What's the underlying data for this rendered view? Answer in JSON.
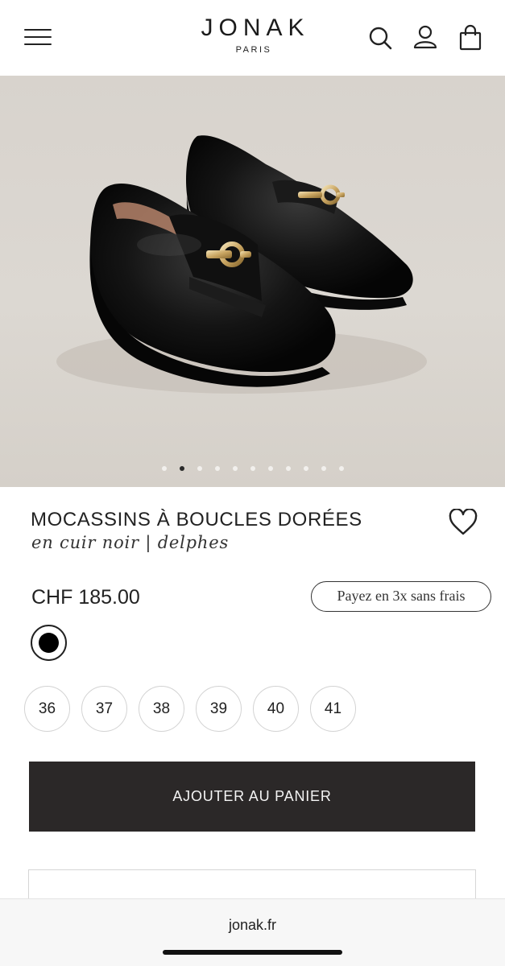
{
  "header": {
    "brand": "JONAK",
    "brand_sub": "PARIS",
    "icons": [
      "menu-icon",
      "search-icon",
      "account-icon",
      "bag-icon"
    ]
  },
  "gallery": {
    "image_count": 11,
    "active_index": 1,
    "dot_color": "#f2f0ed",
    "active_dot_color": "#2a2a2a"
  },
  "product": {
    "title": "MOCASSINS À BOUCLES DORÉES",
    "subtitle": "en cuir noir | delphes",
    "price": "CHF 185.00",
    "payment_option": "Payez en 3x sans frais",
    "selected_color": "#000000",
    "sizes": [
      "36",
      "37",
      "38",
      "39",
      "40",
      "41"
    ]
  },
  "actions": {
    "add_to_cart": "AJOUTER AU PANIER",
    "button_color": "#2b2828"
  },
  "browser": {
    "url": "jonak.fr"
  }
}
